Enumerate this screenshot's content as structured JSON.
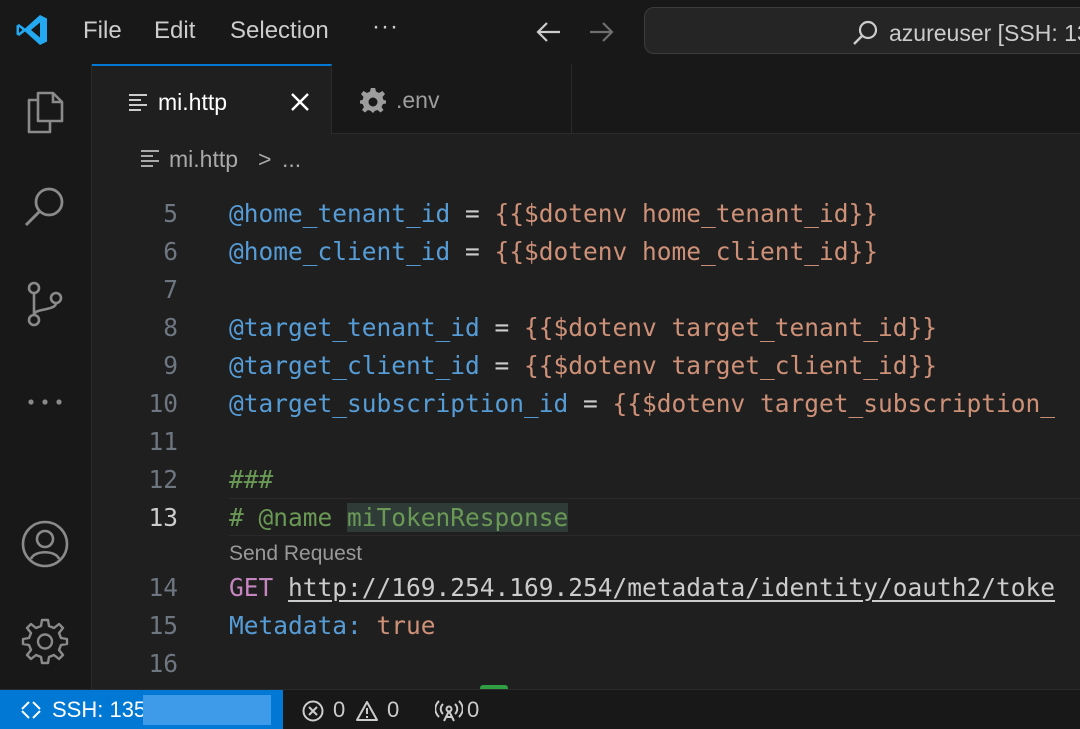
{
  "titlebar": {
    "menu": [
      "File",
      "Edit",
      "Selection"
    ],
    "more_label": "···",
    "command_center_text": "azureuser [SSH: 13"
  },
  "activitybar": {
    "icons": [
      "explorer-icon",
      "search-icon",
      "source-control-icon",
      "more-icon",
      "accounts-icon",
      "settings-gear-icon"
    ]
  },
  "tabs": [
    {
      "label": "mi.http",
      "icon": "file-lines-icon",
      "active": true
    },
    {
      "label": ".env",
      "icon": "gear-icon",
      "active": false
    }
  ],
  "breadcrumb": {
    "file": "mi.http",
    "separator": ">",
    "more": "..."
  },
  "editor": {
    "active_line": 13,
    "lines": [
      {
        "n": "5",
        "parts": [
          [
            "var",
            "@home_tenant_id"
          ],
          [
            "op",
            " = "
          ],
          [
            "str",
            "{{$dotenv home_tenant_id}}"
          ]
        ]
      },
      {
        "n": "6",
        "parts": [
          [
            "var",
            "@home_client_id"
          ],
          [
            "op",
            " = "
          ],
          [
            "str",
            "{{$dotenv home_client_id}}"
          ]
        ]
      },
      {
        "n": "7",
        "parts": []
      },
      {
        "n": "8",
        "parts": [
          [
            "var",
            "@target_tenant_id"
          ],
          [
            "op",
            " = "
          ],
          [
            "str",
            "{{$dotenv target_tenant_id}}"
          ]
        ]
      },
      {
        "n": "9",
        "parts": [
          [
            "var",
            "@target_client_id"
          ],
          [
            "op",
            " = "
          ],
          [
            "str",
            "{{$dotenv target_client_id}}"
          ]
        ]
      },
      {
        "n": "10",
        "parts": [
          [
            "var",
            "@target_subscription_id"
          ],
          [
            "op",
            " = "
          ],
          [
            "str",
            "{{$dotenv target_subscription_"
          ]
        ]
      },
      {
        "n": "11",
        "parts": []
      },
      {
        "n": "12",
        "parts": [
          [
            "comment",
            "###"
          ]
        ]
      },
      {
        "n": "13",
        "parts": [
          [
            "comment",
            "# @name "
          ],
          [
            "sel",
            "miTokenResponse"
          ]
        ]
      },
      {
        "n": "14",
        "parts": [
          [
            "kw-get",
            "GET"
          ],
          [
            "op",
            " "
          ],
          [
            "url",
            "http://169.254.169.254/metadata/identity/oauth2/toke"
          ]
        ]
      },
      {
        "n": "15",
        "parts": [
          [
            "var",
            "Metadata:"
          ],
          [
            "op",
            " "
          ],
          [
            "str",
            "true"
          ]
        ]
      },
      {
        "n": "16",
        "parts": []
      }
    ],
    "codelens": "Send Request"
  },
  "statusbar": {
    "remote": "SSH: 135",
    "errors": "0",
    "warnings": "0",
    "ports": "0",
    "accent": "#0078d4"
  }
}
